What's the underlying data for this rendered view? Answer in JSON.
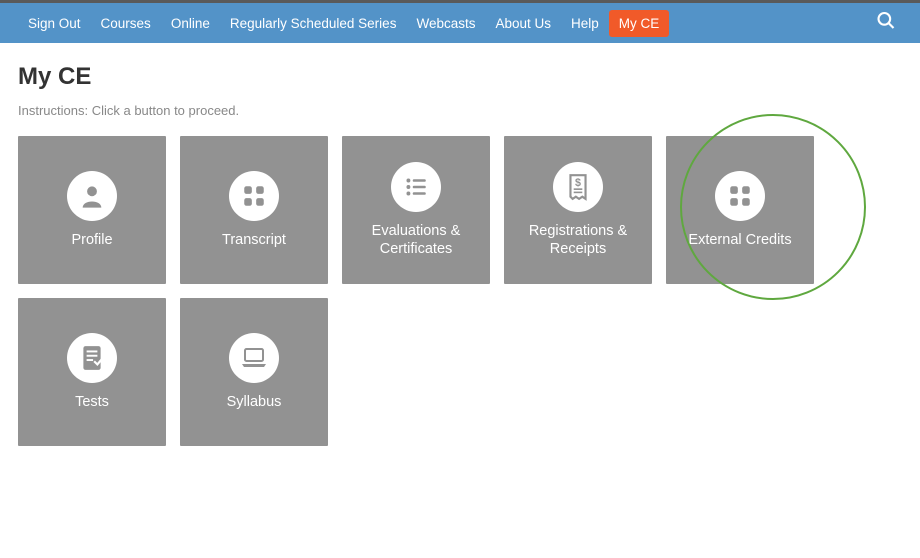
{
  "nav": {
    "items": [
      {
        "label": "Sign Out",
        "active": false
      },
      {
        "label": "Courses",
        "active": false
      },
      {
        "label": "Online",
        "active": false
      },
      {
        "label": "Regularly Scheduled Series",
        "active": false
      },
      {
        "label": "Webcasts",
        "active": false
      },
      {
        "label": "About Us",
        "active": false
      },
      {
        "label": "Help",
        "active": false
      },
      {
        "label": "My CE",
        "active": true
      }
    ]
  },
  "page": {
    "title": "My CE",
    "instructions": "Instructions: Click a button to proceed."
  },
  "tiles": [
    {
      "id": "profile",
      "label": "Profile",
      "icon": "person"
    },
    {
      "id": "transcript",
      "label": "Transcript",
      "icon": "grid"
    },
    {
      "id": "evaluations",
      "label": "Evaluations & Certificates",
      "icon": "list"
    },
    {
      "id": "registrations",
      "label": "Registrations & Receipts",
      "icon": "receipt"
    },
    {
      "id": "external-credits",
      "label": "External Credits",
      "icon": "grid",
      "highlighted": true
    },
    {
      "id": "tests",
      "label": "Tests",
      "icon": "test"
    },
    {
      "id": "syllabus",
      "label": "Syllabus",
      "icon": "laptop"
    }
  ],
  "colors": {
    "navbar": "#5393c8",
    "active": "#f15a29",
    "tile": "#929292",
    "highlight": "#5fa83f"
  }
}
